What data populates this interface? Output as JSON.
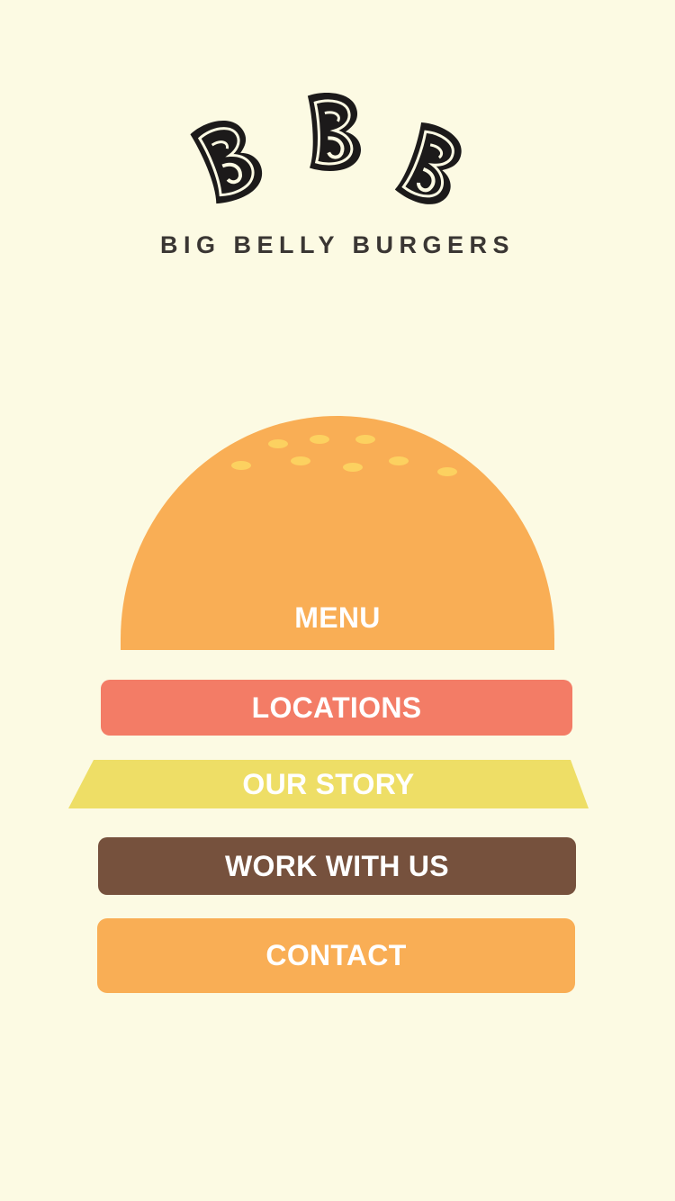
{
  "brand": {
    "name": "BIG BELLY BURGERS"
  },
  "colors": {
    "background": "#fcfae3",
    "bun": "#f9ae55",
    "sesame": "#fcd160",
    "tomato": "#f37c66",
    "cheese": "#eede66",
    "patty": "#76513d",
    "text_dark": "#3a3633"
  },
  "nav": {
    "menu": "MENU",
    "locations": "LOCATIONS",
    "our_story": "OUR STORY",
    "work_with_us": "WORK WITH US",
    "contact": "CONTACT"
  }
}
